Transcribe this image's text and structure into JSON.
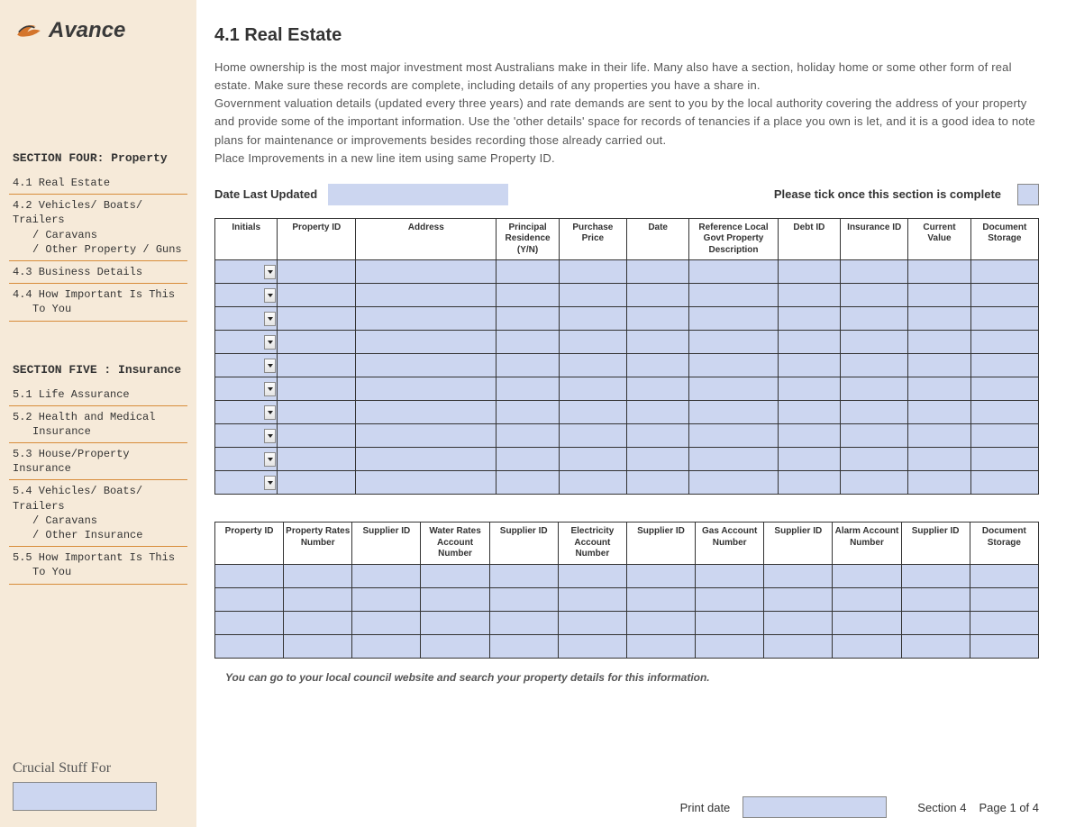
{
  "brand": "Avance",
  "sidebar": {
    "section4_heading": "SECTION FOUR: Property",
    "items4": [
      "4.1 Real Estate",
      "4.2 Vehicles/ Boats/ Trailers\n    / Caravans\n    / Other Property / Guns",
      "4.3 Business Details",
      "4.4 How Important Is This\n    To You"
    ],
    "section5_heading": "SECTION FIVE : Insurance",
    "items5": [
      "5.1 Life Assurance",
      "5.2 Health and Medical\n    Insurance",
      "5.3 House/Property Insurance",
      "5.4 Vehicles/ Boats/ Trailers\n    / Caravans\n    / Other Insurance",
      "5.5 How Important Is This\n    To You"
    ],
    "crucial_label": "Crucial Stuff For"
  },
  "main": {
    "title": "4.1 Real Estate",
    "intro": [
      "Home ownership is the most major investment most Australians make in their life. Many also have a section, holiday home or some other form of real estate. Make sure these records are complete, including details of any properties you have a share in.",
      "Government valuation details (updated every three years) and rate demands are sent to you by the local authority covering the address of your property and provide some of the important information. Use the 'other details' space for records of tenancies if a place you own is let, and it is a good idea to note plans for maintenance or improvements besides recording those already carried out.",
      "Place Improvements in a new line item using same Property ID."
    ],
    "date_last_updated_label": "Date Last Updated",
    "tick_label": "Please tick once this section is complete",
    "table1_headers": [
      "Initials",
      "Property ID",
      "Address",
      "Principal Residence (Y/N)",
      "Purchase Price",
      "Date",
      "Reference Local Govt Property Description",
      "Debt ID",
      "Insurance ID",
      "Current Value",
      "Document Storage"
    ],
    "table1_rows": 10,
    "table1_col_widths": [
      60,
      75,
      135,
      60,
      65,
      60,
      85,
      60,
      65,
      60,
      65
    ],
    "table2_headers": [
      "Property ID",
      "Property Rates Number",
      "Supplier ID",
      "Water Rates Account Number",
      "Supplier ID",
      "Electricity Account Number",
      "Supplier ID",
      "Gas Account Number",
      "Supplier ID",
      "Alarm Account Number",
      "Supplier ID",
      "Document Storage"
    ],
    "table2_rows": 4,
    "note": "You can go to your local council website and search your property details for this information.",
    "footer": {
      "print_date_label": "Print date",
      "section_label": "Section 4",
      "page_label": "Page 1 of 4"
    }
  }
}
